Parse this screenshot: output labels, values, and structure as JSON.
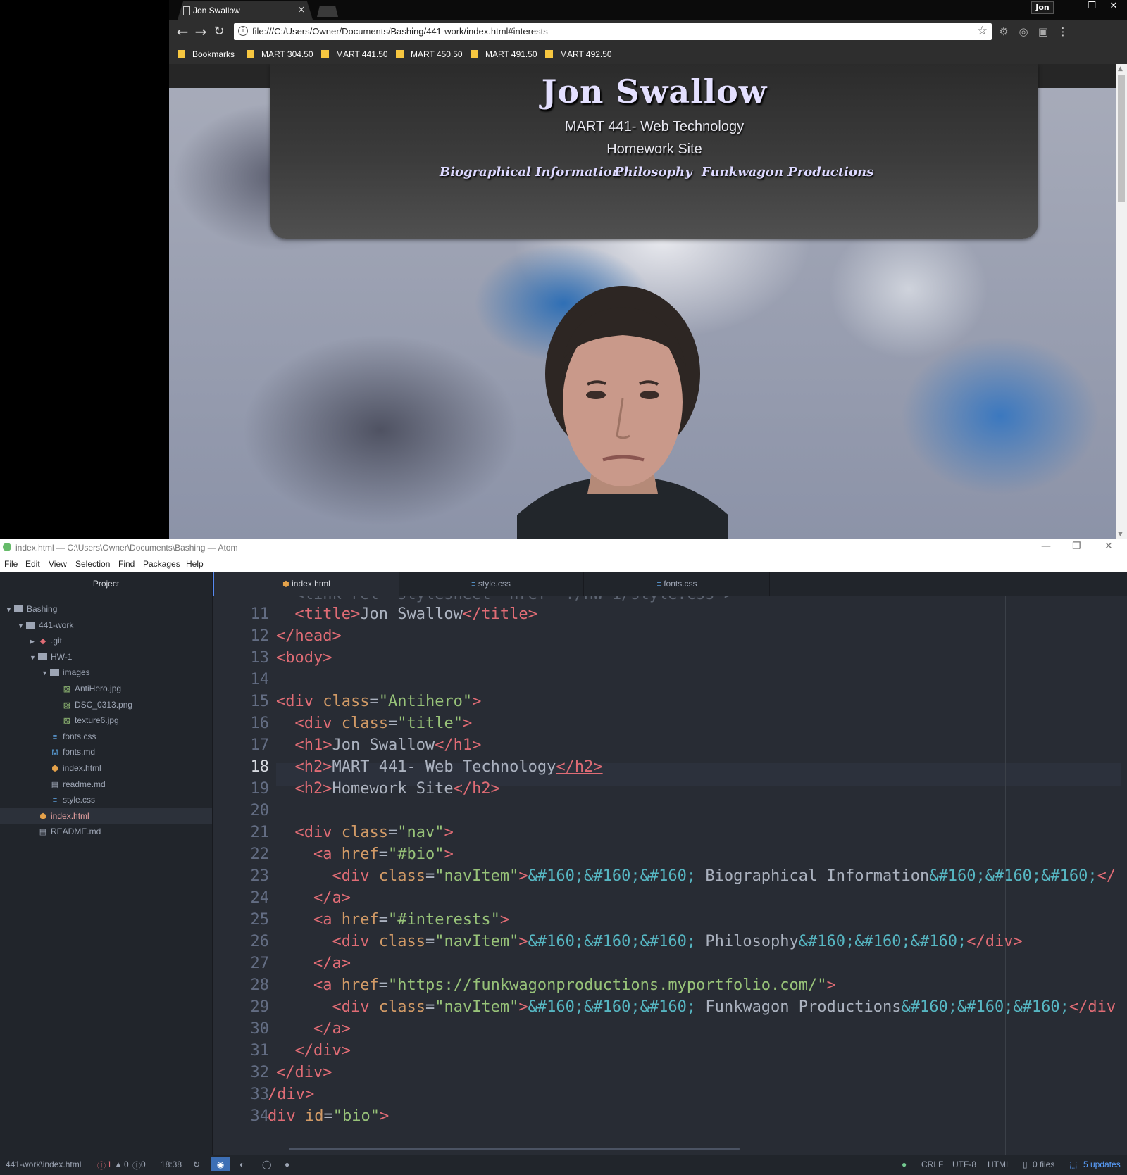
{
  "browser": {
    "tab_title": "Jon Swallow",
    "tab_close": "×",
    "profile": "Jon",
    "win_min": "—",
    "win_restore": "❐",
    "win_close": "✕",
    "url": "file:///C:/Users/Owner/Documents/Bashing/441-work/index.html#interests",
    "bookmarks": [
      "Bookmarks",
      "MART 304.50",
      "MART 441.50",
      "MART 450.50",
      "MART 491.50",
      "MART 492.50"
    ]
  },
  "site": {
    "h1": "Jon Swallow",
    "h2_course": "MART 441- Web Technology",
    "h2_sub": "Homework Site",
    "nav": [
      "Biographical Information",
      "Philosophy",
      "Funkwagon Productions"
    ]
  },
  "atom": {
    "window_title": "index.html — C:\\Users\\Owner\\Documents\\Bashing — Atom",
    "menu": [
      "File",
      "Edit",
      "View",
      "Selection",
      "Find",
      "Packages",
      "Help"
    ],
    "project_label": "Project",
    "tree": [
      {
        "label": "Bashing",
        "kind": "dir",
        "depth": 0,
        "open": true
      },
      {
        "label": "441-work",
        "kind": "dir",
        "depth": 1,
        "open": true
      },
      {
        "label": ".git",
        "kind": "git",
        "depth": 2,
        "open": false
      },
      {
        "label": "HW-1",
        "kind": "dir",
        "depth": 2,
        "open": true
      },
      {
        "label": "images",
        "kind": "dir",
        "depth": 3,
        "open": true
      },
      {
        "label": "AntiHero.jpg",
        "kind": "image",
        "depth": 4
      },
      {
        "label": "DSC_0313.png",
        "kind": "image",
        "depth": 4
      },
      {
        "label": "texture6.jpg",
        "kind": "image",
        "depth": 4
      },
      {
        "label": "fonts.css",
        "kind": "css",
        "depth": 3
      },
      {
        "label": "fonts.md",
        "kind": "md",
        "depth": 3
      },
      {
        "label": "index.html",
        "kind": "html",
        "depth": 3
      },
      {
        "label": "readme.md",
        "kind": "book",
        "depth": 3
      },
      {
        "label": "style.css",
        "kind": "css",
        "depth": 3
      },
      {
        "label": "index.html",
        "kind": "html",
        "depth": 2,
        "selected": true
      },
      {
        "label": "README.md",
        "kind": "book",
        "depth": 2
      }
    ],
    "tabs": [
      "index.html",
      "style.css",
      "fonts.css"
    ],
    "line_numbers": [
      "11",
      "12",
      "13",
      "14",
      "15",
      "16",
      "17",
      "18",
      "19",
      "20",
      "21",
      "22",
      "23",
      "24",
      "25",
      "26",
      "27",
      "28",
      "29",
      "30",
      "31",
      "32",
      "33",
      "34"
    ],
    "current_line": "18",
    "status": {
      "path": "441-work\\index.html",
      "errors": "1",
      "warnings": "0",
      "infos": "0",
      "cursor": "18:38",
      "line_ending": "CRLF",
      "encoding": "UTF-8",
      "grammar": "HTML",
      "files": "0 files",
      "updates": "5 updates"
    }
  },
  "colors": {
    "tag": "#e06c75",
    "attr": "#d19a66",
    "string": "#98c379",
    "entity": "#56b6c2",
    "editor_bg": "#282c34"
  }
}
